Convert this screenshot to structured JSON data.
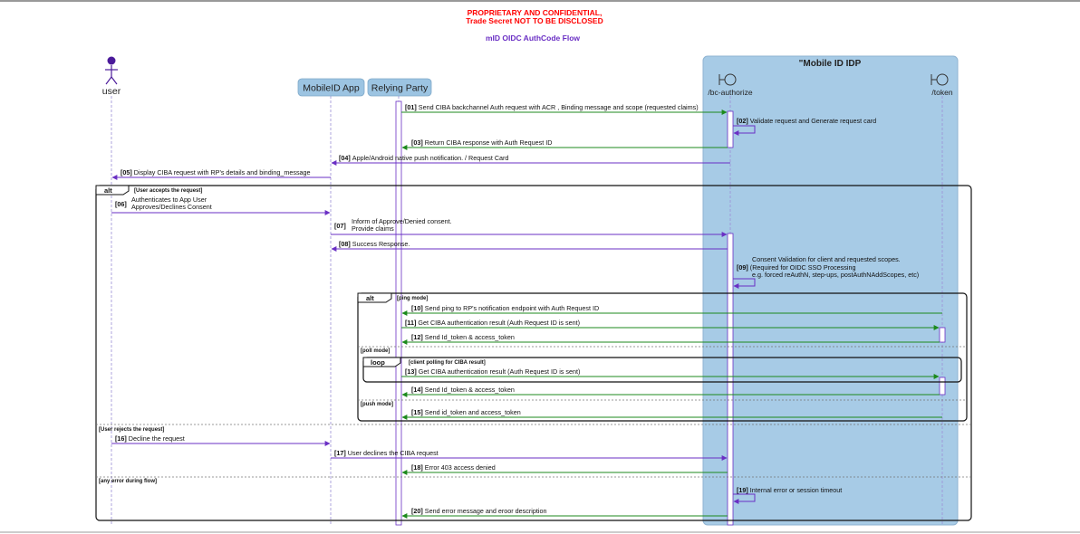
{
  "header": {
    "confidential_line1": "PROPRIETARY AND CONFIDENTIAL,",
    "confidential_line2": "Trade Secret NOT TO BE DISCLOSED",
    "title": "mID OIDC AuthCode Flow"
  },
  "idp_box_title": "\"Mobile ID IDP",
  "participants": {
    "user": "user",
    "app": "MobileID App",
    "rp": "Relying Party",
    "bc": "/bc-authorize",
    "token": "/token"
  },
  "messages": [
    {
      "num": "[01]",
      "text": "Send CIBA backchannel Auth request with ACR , Binding message and scope (requested claims)"
    },
    {
      "num": "[02]",
      "text": "Validate request and Generate request card"
    },
    {
      "num": "[03]",
      "text": "Return CIBA response with Auth Request ID"
    },
    {
      "num": "[04]",
      "text": "Apple/Android native push notification. / Request Card"
    },
    {
      "num": "[05]",
      "text": "Display CIBA request with RP's details and binding_message"
    },
    {
      "num": "[06]",
      "text": "Authenticates to App User",
      "text2": "Approves/Declines Consent"
    },
    {
      "num": "[07]",
      "text": "Inform of Approve/Denied consent.",
      "text2": "Provide claims"
    },
    {
      "num": "[08]",
      "text": "Success Response."
    },
    {
      "num": "[09]",
      "pre": "Consent Validation for client and requested scopes.",
      "text": "(Required for OIDC SSO Processing",
      "text2": "e.g. forced reAuthN, step-ups, postAuthNAddScopes, etc)"
    },
    {
      "num": "[10]",
      "text": "Send ping to RP's notification endpoint with Auth Request ID"
    },
    {
      "num": "[11]",
      "text": "Get CIBA authentication result (Auth Request ID is sent)"
    },
    {
      "num": "[12]",
      "text": "Send Id_token & access_token"
    },
    {
      "num": "[13]",
      "text": "Get CIBA authentication result (Auth Request ID is sent)"
    },
    {
      "num": "[14]",
      "text": "Send Id_token & access_token"
    },
    {
      "num": "[15]",
      "text": "Send id_token and access_token"
    },
    {
      "num": "[16]",
      "text": "Decline the request"
    },
    {
      "num": "[17]",
      "text": "User declines the CIBA request"
    },
    {
      "num": "[18]",
      "text": "Error 403 access denied"
    },
    {
      "num": "[19]",
      "text": "Internal error or session timeout"
    },
    {
      "num": "[20]",
      "text": "Send error message and eroor description"
    }
  ],
  "frames": {
    "outer_alt": "alt",
    "outer_guard1": "[User accepts the request]",
    "outer_guard2": "[User rejects the request]",
    "outer_guard3": "[any error during flow]",
    "inner_alt": "alt",
    "inner_guard1": "[ping mode]",
    "inner_guard2": "[poll mode]",
    "inner_guard3": "[push mode]",
    "loop": "loop",
    "loop_guard": "[client polling for CIBA result]"
  },
  "colors": {
    "confidential": "#ff0000",
    "title": "#6a2fc4",
    "purple_arrow": "#6a2fc4",
    "green_arrow": "#1c8a1c",
    "idp_box": "#a7cbe6",
    "participant_box": "#9cc4e2",
    "actor": "#4b1a9a"
  }
}
